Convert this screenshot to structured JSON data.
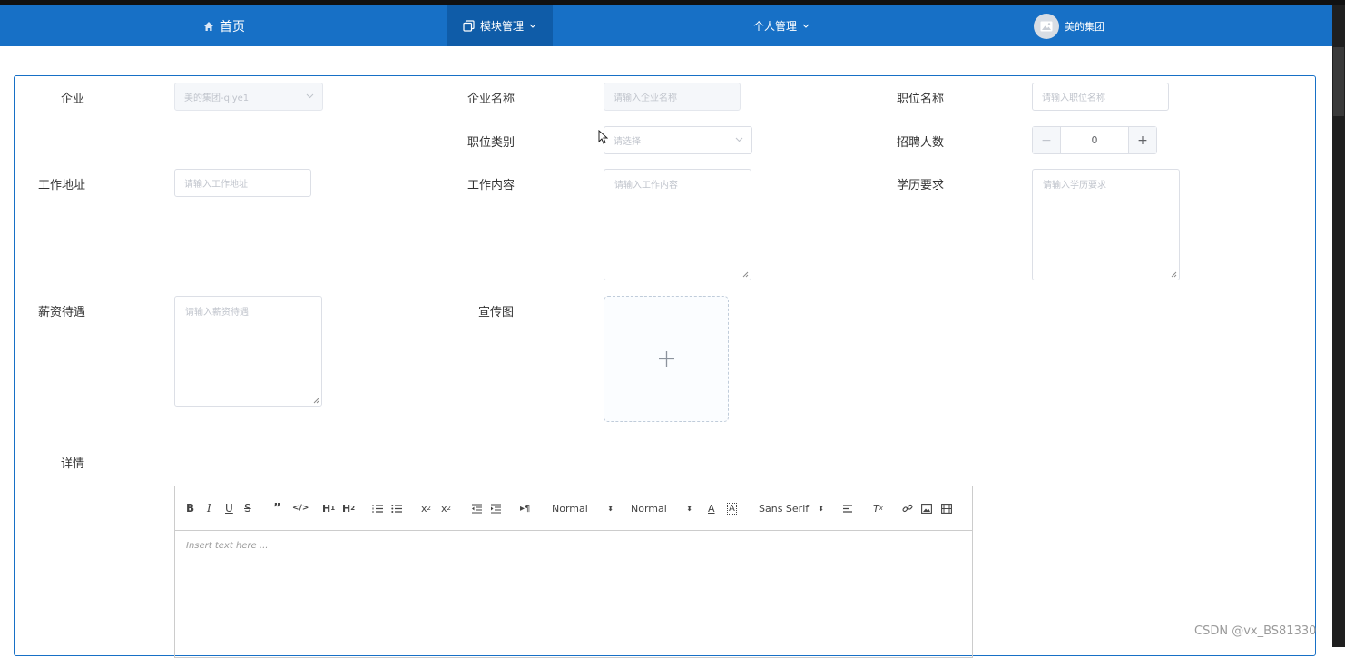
{
  "nav": {
    "home": "首页",
    "module": "模块管理",
    "personal": "个人管理",
    "company": "美的集团"
  },
  "form": {
    "company_label": "企业",
    "company_value": "美的集团-qiye1",
    "company_name_label": "企业名称",
    "company_name_placeholder": "请输入企业名称",
    "position_name_label": "职位名称",
    "position_name_placeholder": "请输入职位名称",
    "position_type_label": "职位类别",
    "position_type_placeholder": "请选择",
    "headcount_label": "招聘人数",
    "headcount_value": "0",
    "work_address_label": "工作地址",
    "work_address_placeholder": "请输入工作地址",
    "work_content_label": "工作内容",
    "work_content_placeholder": "请输入工作内容",
    "education_label": "学历要求",
    "education_placeholder": "请输入学历要求",
    "salary_label": "薪资待遇",
    "salary_placeholder": "请输入薪资待遇",
    "promo_label": "宣传图",
    "detail_label": "详情"
  },
  "editor": {
    "header_select": "Normal",
    "size_select": "Normal",
    "font_select": "Sans Serif",
    "placeholder": "Insert text here ..."
  },
  "watermark": "CSDN @vx_BS81330",
  "colors": {
    "nav": "#1770c6",
    "nav_active": "#0f5ca8",
    "card_border": "#1770c6"
  }
}
